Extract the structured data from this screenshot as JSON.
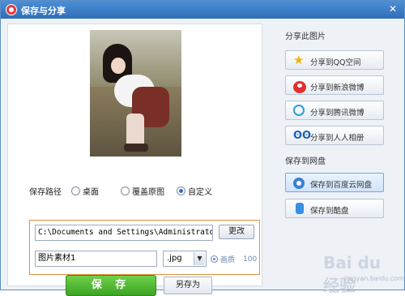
{
  "window": {
    "title": "保存与分享",
    "close_glyph": "✕"
  },
  "save_path": {
    "label": "保存路径",
    "options": [
      {
        "label": "桌面",
        "selected": false
      },
      {
        "label": "覆盖原图",
        "selected": false
      },
      {
        "label": "自定义",
        "selected": true
      }
    ],
    "path_value": "C:\\Documents and Settings\\Administrator\\桌",
    "change_label": "更改"
  },
  "file": {
    "name_value": "图片素材1",
    "extension": ".jpg",
    "quality_label": "画质",
    "quality_value": "100"
  },
  "actions": {
    "save_label": "保 存",
    "save_as_label": "另存为"
  },
  "share": {
    "section_title": "分享此图片",
    "buttons": [
      {
        "label": "分享到QQ空间",
        "icon": "qzone-star-icon"
      },
      {
        "label": "分享到新浪微博",
        "icon": "sina-weibo-icon"
      },
      {
        "label": "分享到腾讯微博",
        "icon": "tencent-weibo-icon"
      },
      {
        "label": "分享到人人相册",
        "icon": "renren-icon"
      }
    ]
  },
  "cloud": {
    "section_title": "保存到网盘",
    "buttons": [
      {
        "label": "保存到百度云网盘",
        "icon": "baidu-cloud-icon",
        "highlighted": true
      },
      {
        "label": "保存到酷盘",
        "icon": "kuaipan-icon",
        "highlighted": false
      }
    ]
  },
  "watermark": {
    "main": "Bai du 经验",
    "sub": "jingyan.baidu.com"
  },
  "colors": {
    "title_bar": "#2f6eb8",
    "save_button": "#3ca424",
    "highlight_box": "#e8903a"
  }
}
